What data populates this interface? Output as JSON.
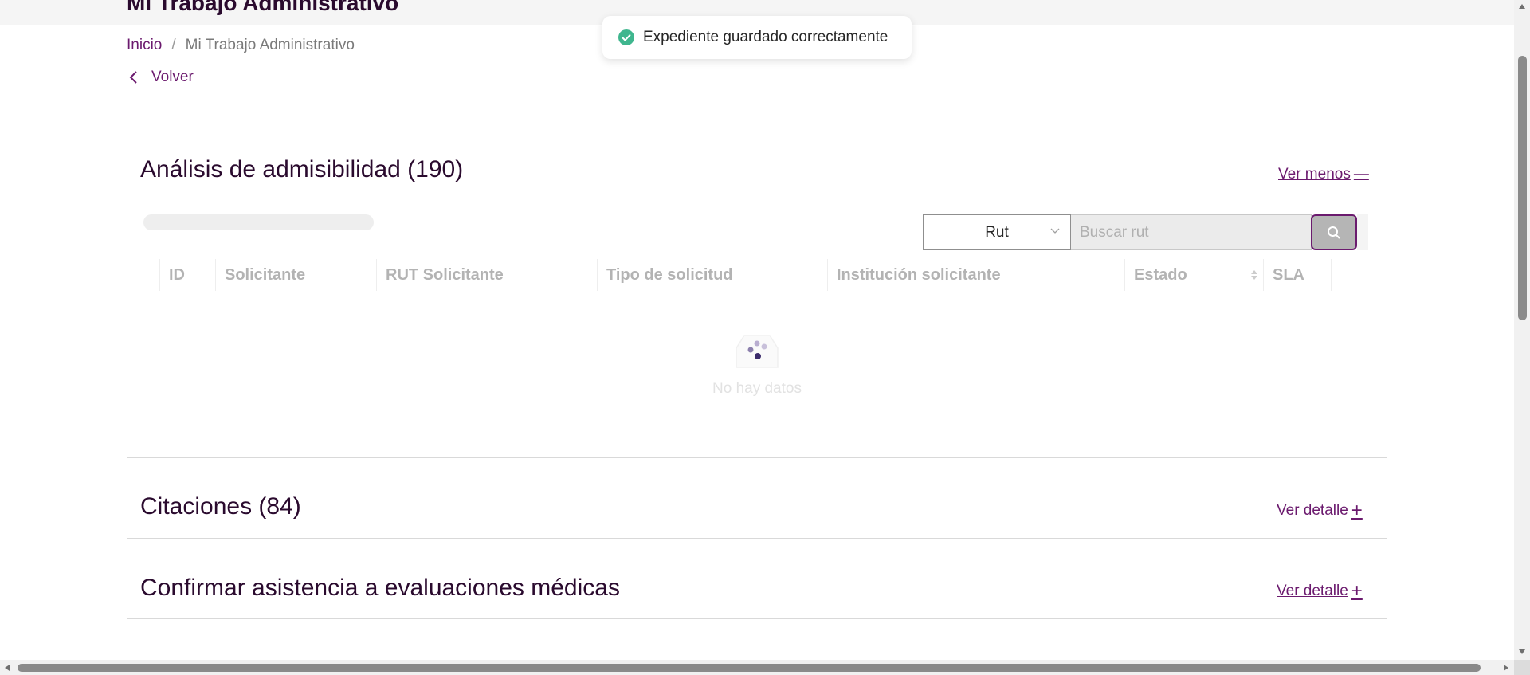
{
  "header": {
    "title": "Mi Trabajo Administrativo"
  },
  "breadcrumb": {
    "home": "Inicio",
    "separator": "/",
    "current": "Mi Trabajo Administrativo"
  },
  "back": {
    "label": "Volver"
  },
  "toast": {
    "message": "Expediente guardado correctamente",
    "icon": "check-circle-icon",
    "color": "#3fb68e"
  },
  "sections": {
    "admisibilidad": {
      "title": "Análisis de admisibilidad (190)",
      "toggle_label": "Ver menos",
      "toggle_symbol": "—",
      "filter": {
        "select_value": "Rut",
        "search_placeholder": "Buscar rut"
      },
      "columns": [
        "ID",
        "Solicitante",
        "RUT Solicitante",
        "Tipo de solicitud",
        "Institución solicitante",
        "Estado",
        "SLA"
      ],
      "empty_text": "No hay datos"
    },
    "citaciones": {
      "title": "Citaciones (84)",
      "toggle_label": "Ver detalle",
      "toggle_symbol": "+"
    },
    "confirmar": {
      "title": "Confirmar asistencia a evaluaciones médicas",
      "toggle_label": "Ver detalle",
      "toggle_symbol": "+"
    }
  },
  "colors": {
    "accent": "#6b1a6e",
    "text": "#2a0a2e"
  }
}
